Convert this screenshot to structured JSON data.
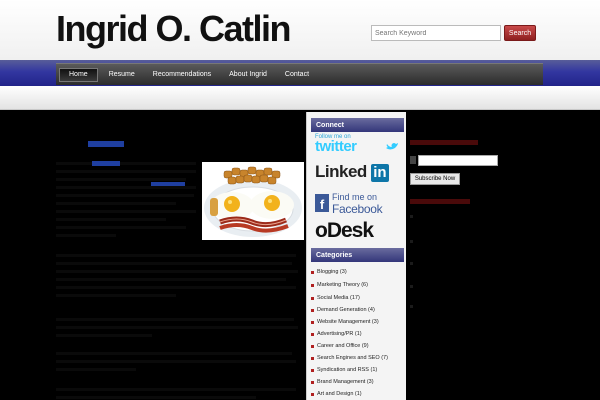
{
  "header": {
    "site_title": "Ingrid O. Catlin",
    "search_placeholder": "Search Keyword",
    "search_button": "Search"
  },
  "nav": {
    "items": [
      {
        "label": "Home"
      },
      {
        "label": "Resume"
      },
      {
        "label": "Recommendations"
      },
      {
        "label": "About Ingrid"
      },
      {
        "label": "Contact"
      }
    ]
  },
  "sidebar": {
    "connect_heading": "Connect",
    "twitter": {
      "caption": "Follow me on",
      "label": "twitter"
    },
    "linkedin": {
      "label": "Linked",
      "label_in": "in"
    },
    "facebook": {
      "caption": "Find me on",
      "label": "Facebook",
      "icon_letter": "f"
    },
    "odesk": {
      "label": "oDesk"
    },
    "categories_heading": "Categories",
    "categories": [
      {
        "label": "Blogging (3)"
      },
      {
        "label": "Marketing Theory (6)"
      },
      {
        "label": "Social Media (17)"
      },
      {
        "label": "Demand Generation (4)"
      },
      {
        "label": "Website Management (3)"
      },
      {
        "label": "Advertising/PR (1)"
      },
      {
        "label": "Career and Office (9)"
      },
      {
        "label": "Search Engines and SEO (7)"
      },
      {
        "label": "Syndication and RSS (1)"
      },
      {
        "label": "Brand Management (3)"
      },
      {
        "label": "Art and Design (1)"
      }
    ]
  },
  "right": {
    "subscribe_button": "Subscribe Now"
  },
  "colors": {
    "nav_blue": "#3236a0",
    "search_red": "#b02a2a",
    "title_link": "#1f3fa0",
    "twitter_blue": "#33ccff",
    "linkedin_blue": "#0e76a8",
    "facebook_blue": "#3b5998",
    "odesk_blue": "#2d63ad"
  }
}
